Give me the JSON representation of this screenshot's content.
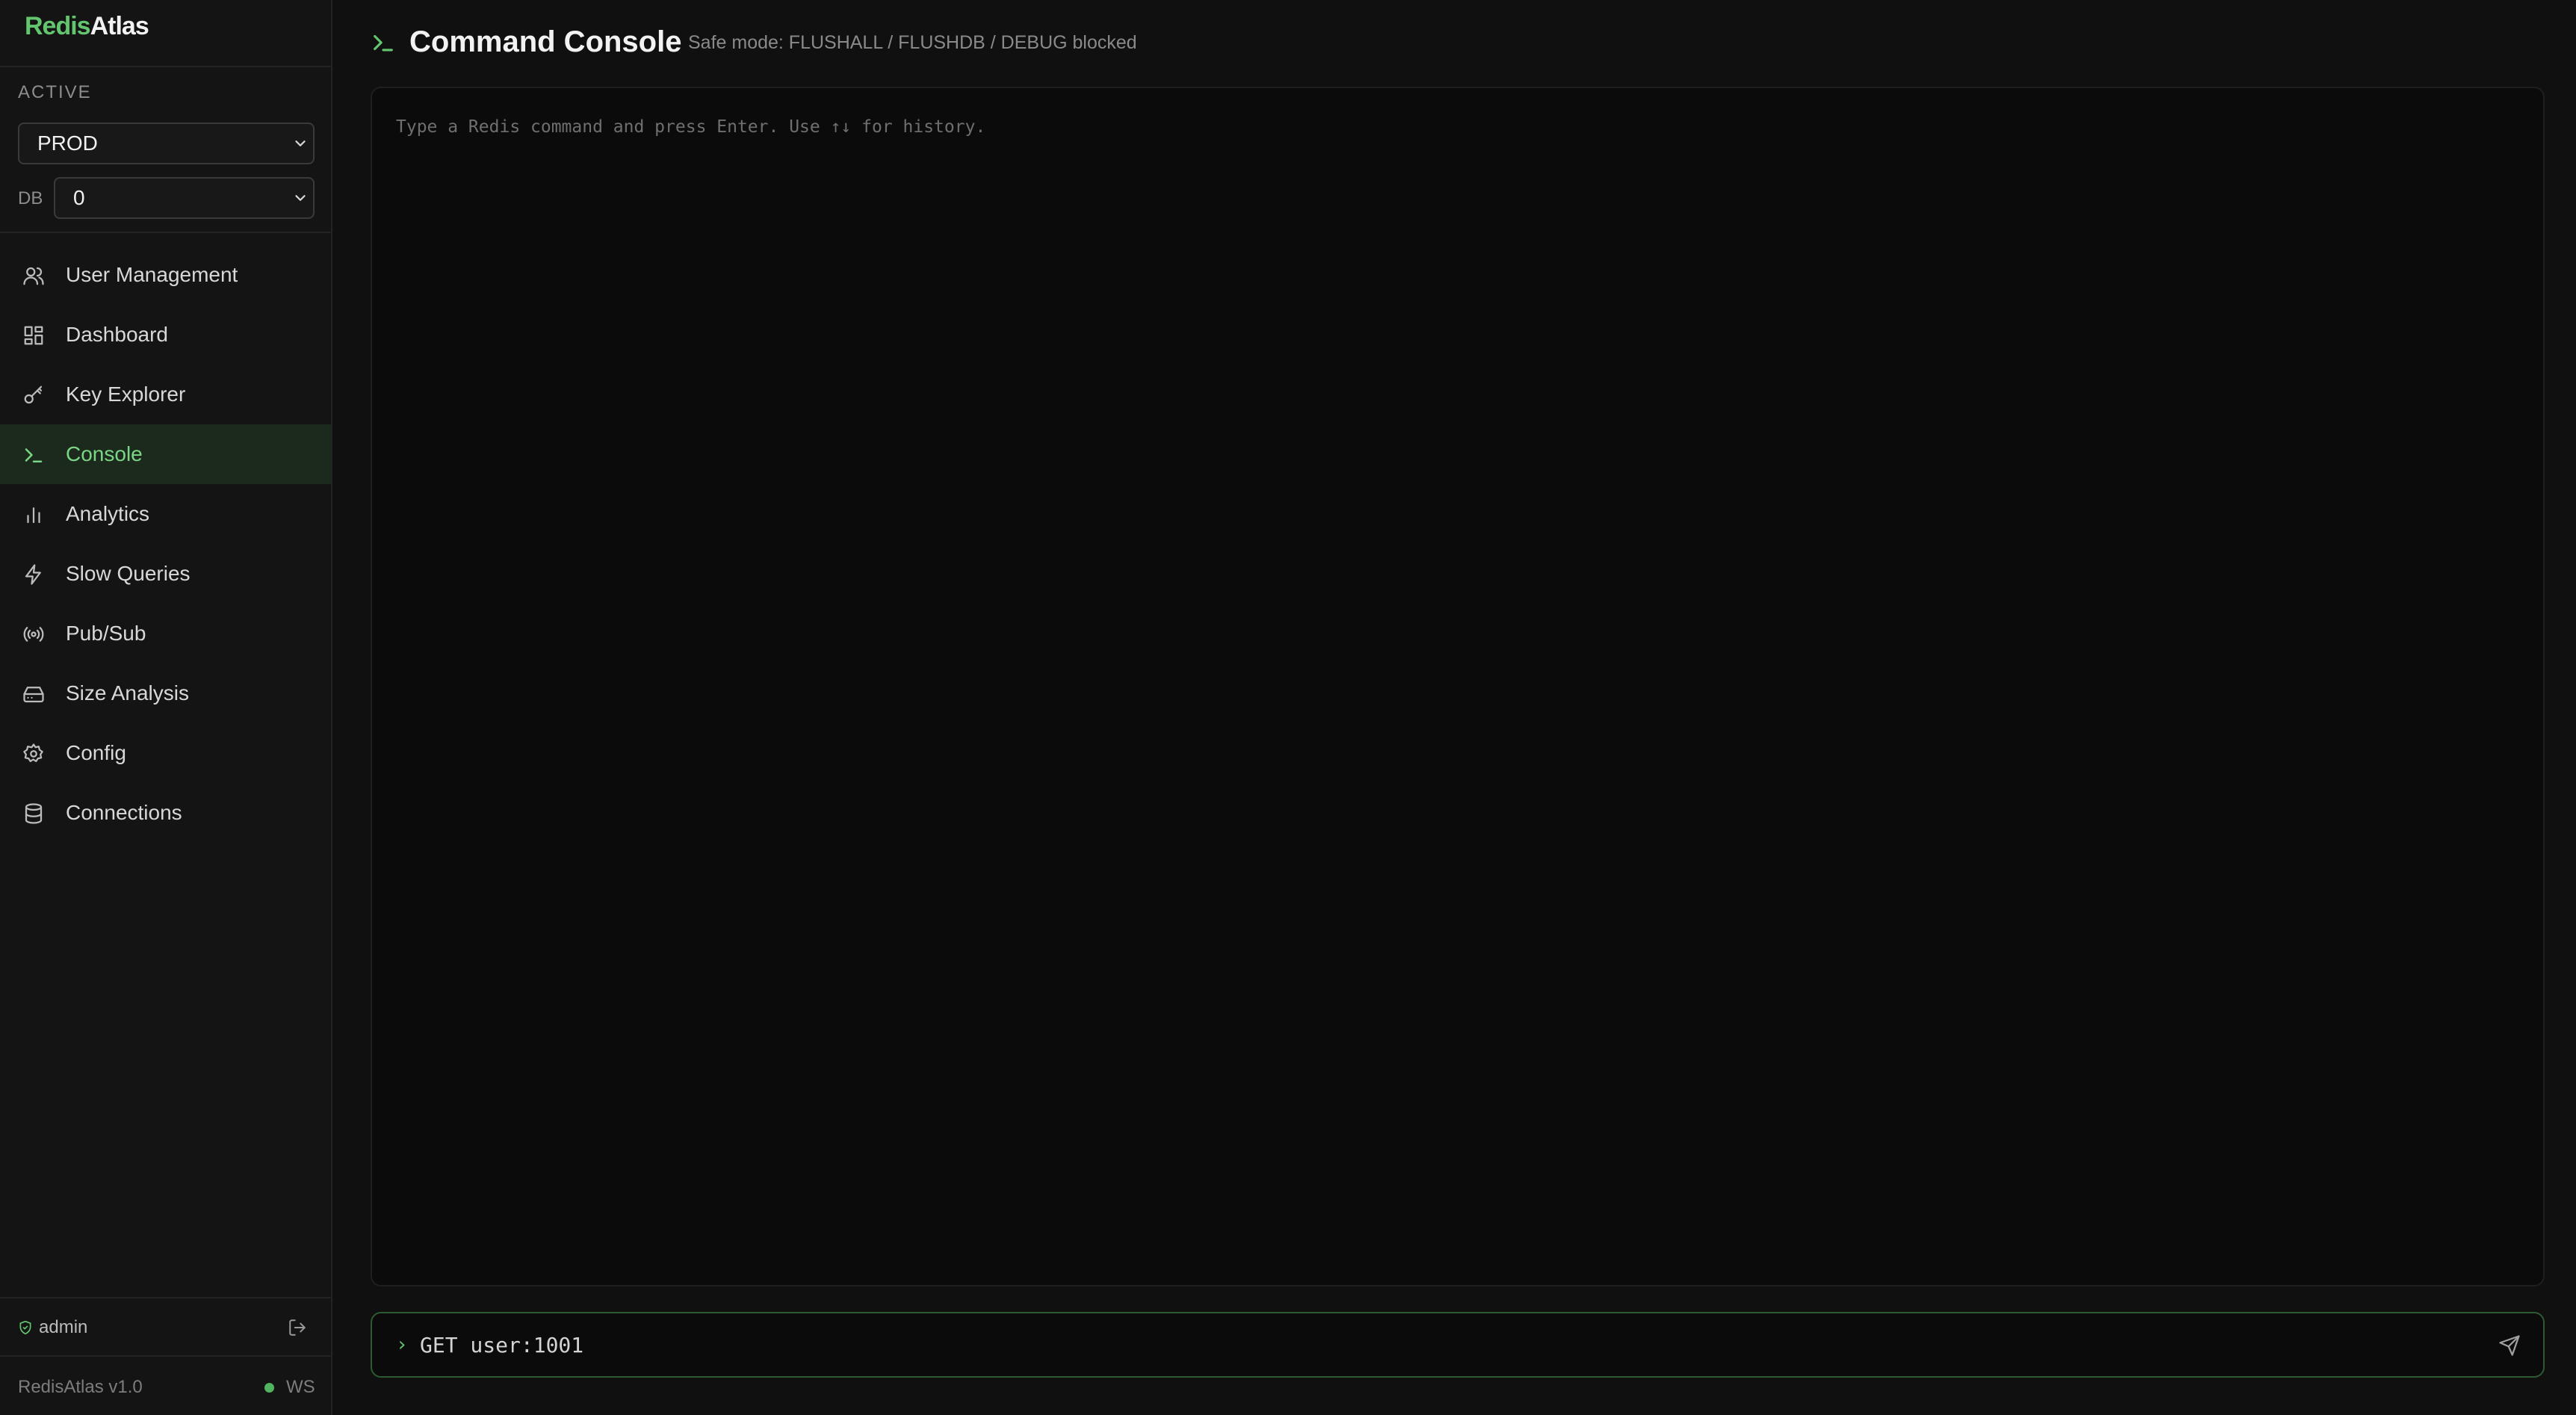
{
  "app": {
    "logo_part1": "Redis",
    "logo_part2": "Atlas",
    "version": "RedisAtlas v1.0",
    "ws_label": "WS"
  },
  "sidebar": {
    "active_label": "ACTIVE",
    "connection_value": "PROD",
    "db_label": "DB",
    "db_value": "0",
    "items": [
      {
        "label": "User Management",
        "icon": "users-icon"
      },
      {
        "label": "Dashboard",
        "icon": "grid-icon"
      },
      {
        "label": "Key Explorer",
        "icon": "key-icon"
      },
      {
        "label": "Console",
        "icon": "terminal-icon",
        "active": true
      },
      {
        "label": "Analytics",
        "icon": "bar-chart-icon"
      },
      {
        "label": "Slow Queries",
        "icon": "zap-icon"
      },
      {
        "label": "Pub/Sub",
        "icon": "radio-icon"
      },
      {
        "label": "Size Analysis",
        "icon": "hard-drive-icon"
      },
      {
        "label": "Config",
        "icon": "gear-icon"
      },
      {
        "label": "Connections",
        "icon": "database-icon"
      }
    ],
    "user": "admin"
  },
  "main": {
    "title": "Command Console",
    "safe_mode_note": "Safe mode: FLUSHALL / FLUSHDB / DEBUG blocked",
    "console_hint": "Type a Redis command and press Enter. Use ↑↓ for history.",
    "prompt_symbol": "›",
    "command_value": "GET user:1001"
  },
  "colors": {
    "accent": "#63c66f",
    "background": "#101010",
    "sidebar_bg": "#141414",
    "active_bg": "#1c2a1d",
    "status_ok": "#52b35e"
  }
}
